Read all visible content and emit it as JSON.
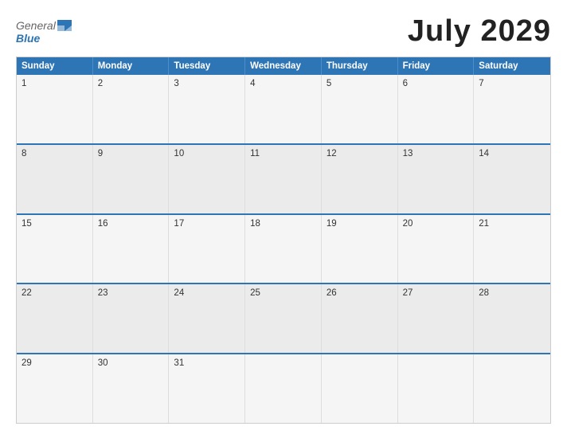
{
  "header": {
    "logo_general": "General",
    "logo_blue": "Blue",
    "title": "July 2029"
  },
  "calendar": {
    "days_of_week": [
      "Sunday",
      "Monday",
      "Tuesday",
      "Wednesday",
      "Thursday",
      "Friday",
      "Saturday"
    ],
    "weeks": [
      [
        1,
        2,
        3,
        4,
        5,
        6,
        7
      ],
      [
        8,
        9,
        10,
        11,
        12,
        13,
        14
      ],
      [
        15,
        16,
        17,
        18,
        19,
        20,
        21
      ],
      [
        22,
        23,
        24,
        25,
        26,
        27,
        28
      ],
      [
        29,
        30,
        31,
        "",
        "",
        "",
        ""
      ]
    ]
  }
}
